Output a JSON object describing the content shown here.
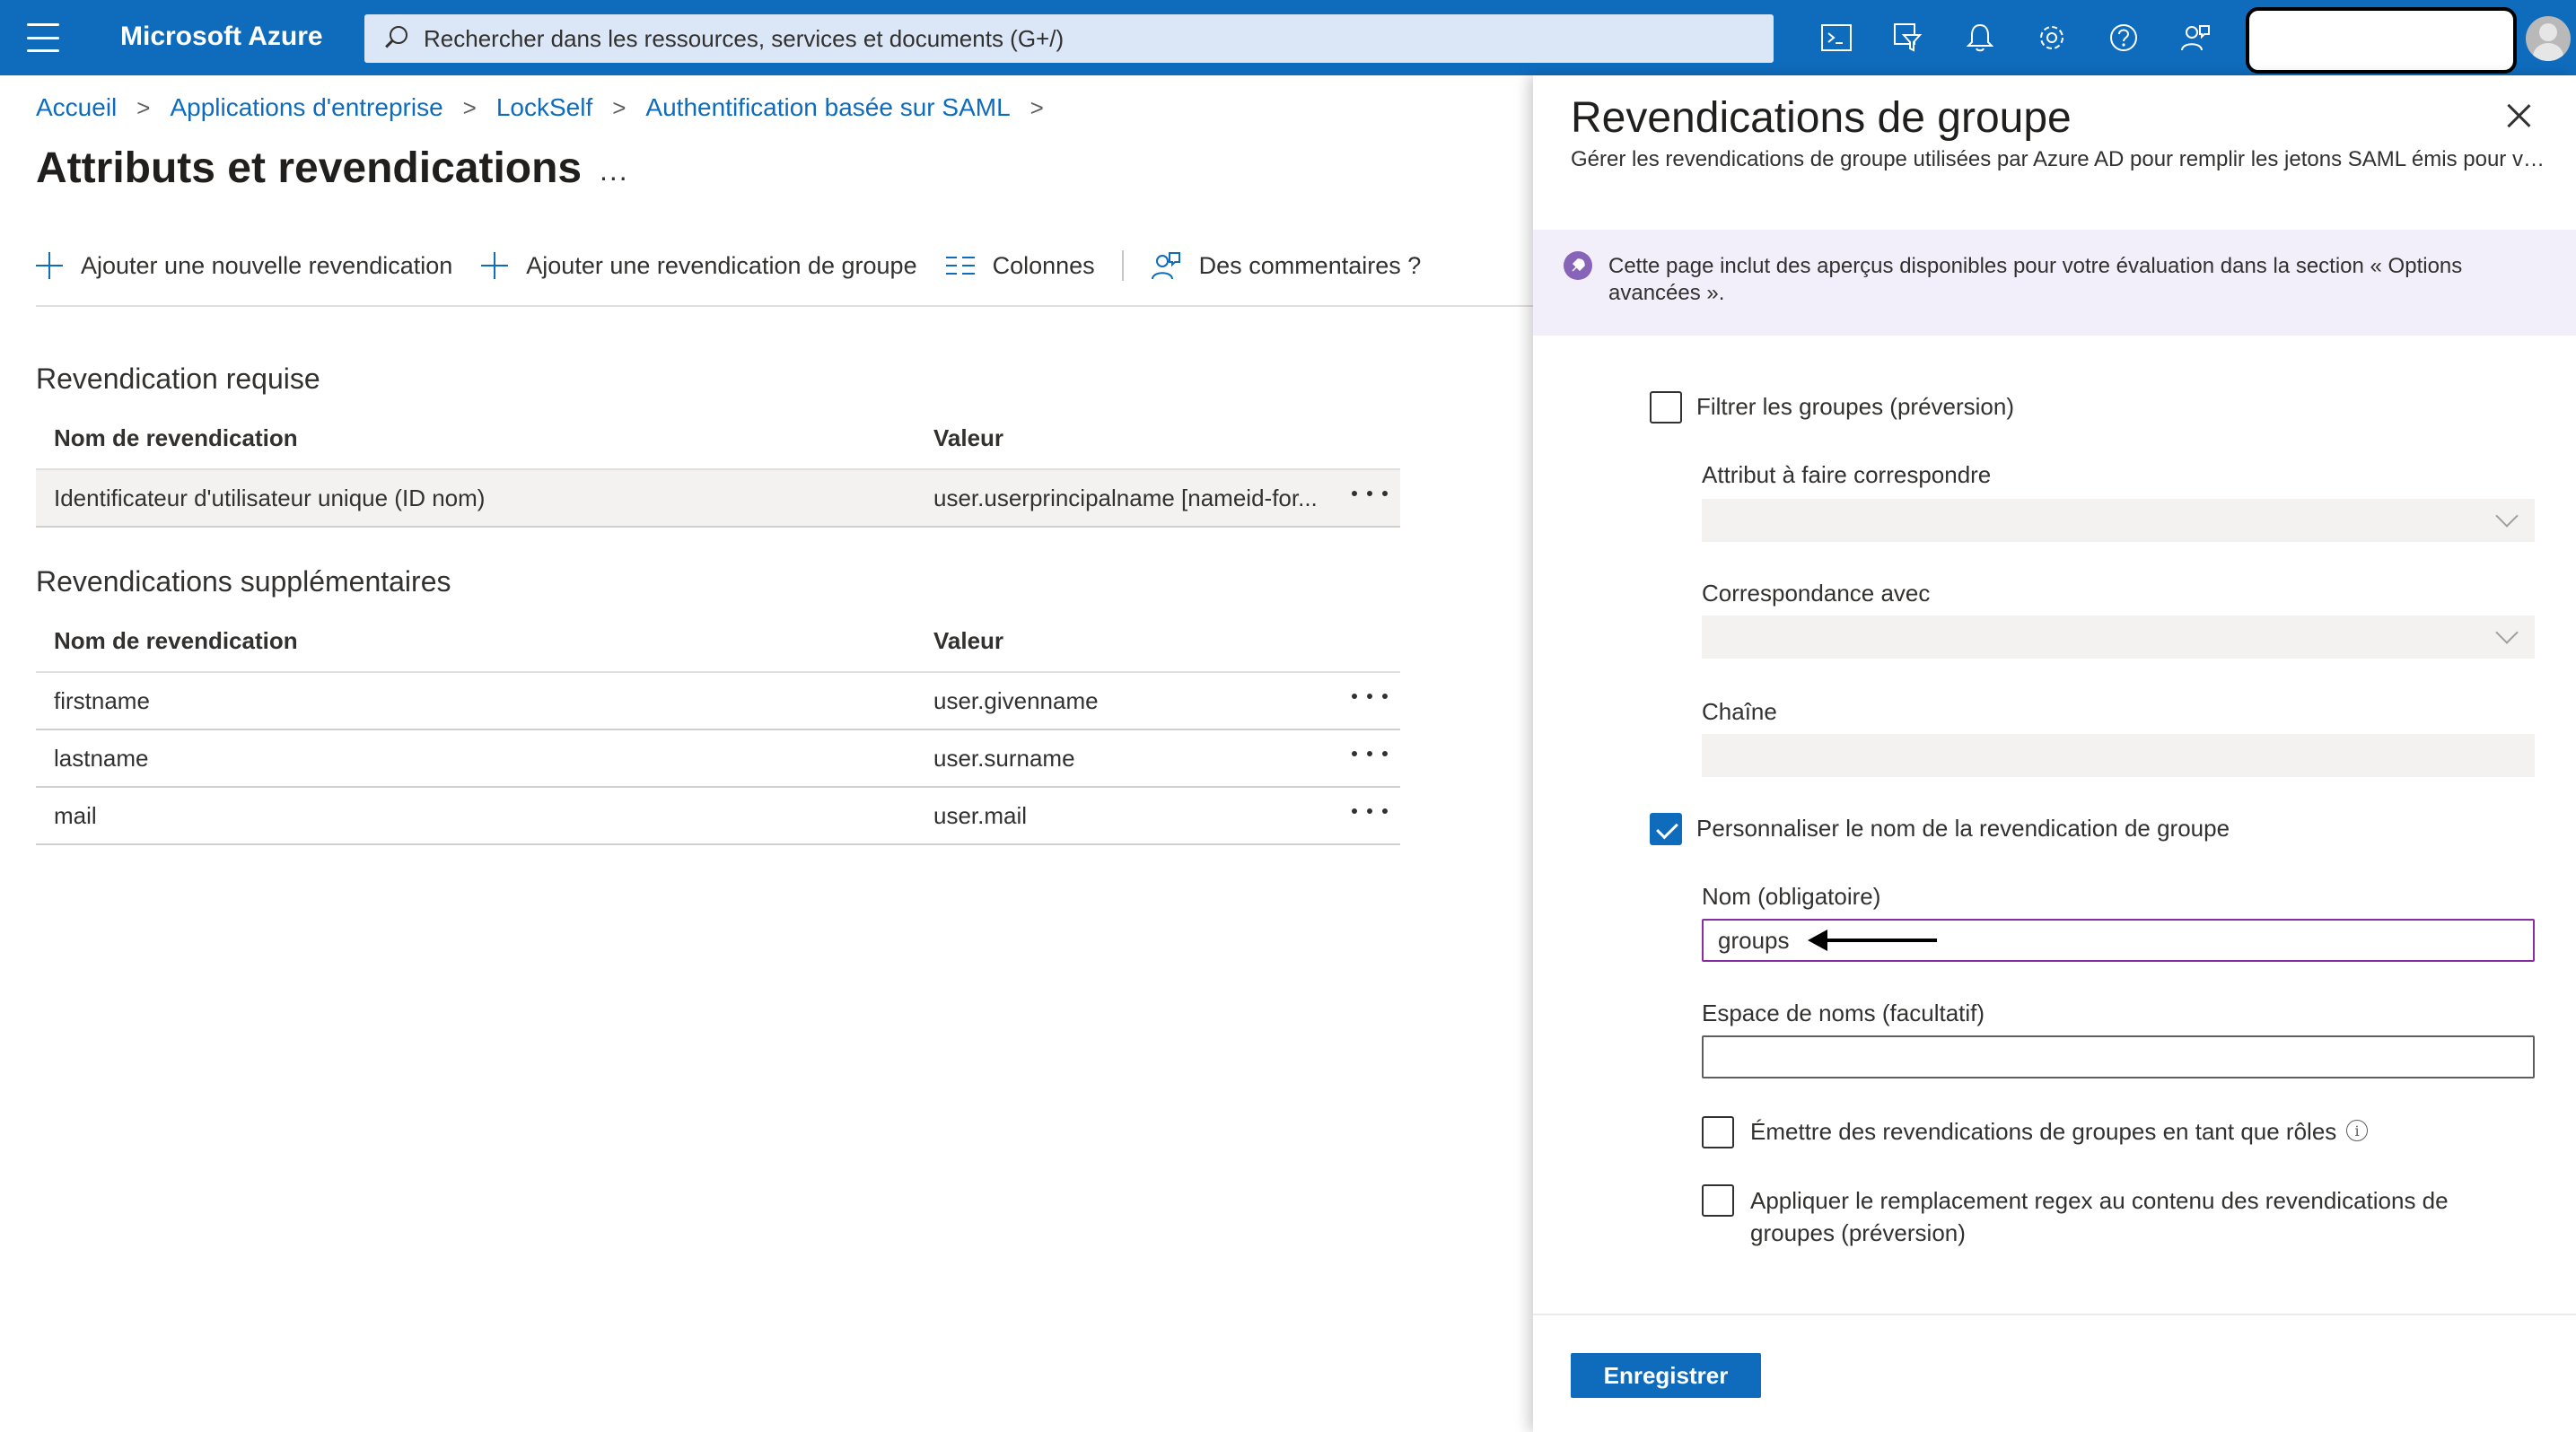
{
  "topbar": {
    "brand": "Microsoft Azure",
    "search_placeholder": "Rechercher dans les ressources, services et documents (G+/)",
    "icons": [
      "menu-icon",
      "cloud-shell-icon",
      "directory-filter-icon",
      "notifications-icon",
      "settings-icon",
      "help-icon",
      "feedback-icon"
    ]
  },
  "breadcrumb": {
    "items": [
      "Accueil",
      "Applications d'entreprise",
      "LockSelf",
      "Authentification basée sur SAML"
    ]
  },
  "page": {
    "title": "Attributs et revendications",
    "more": "..."
  },
  "toolbar": {
    "add_claim": "Ajouter une nouvelle revendication",
    "add_group_claim": "Ajouter une revendication de groupe",
    "columns": "Colonnes",
    "feedback": "Des commentaires ?"
  },
  "required_claims": {
    "title": "Revendication requise",
    "headers": [
      "Nom de revendication",
      "Valeur"
    ],
    "rows": [
      {
        "name": "Identificateur d'utilisateur unique (ID nom)",
        "value": "user.userprincipalname [nameid-for..."
      }
    ]
  },
  "additional_claims": {
    "title": "Revendications supplémentaires",
    "headers": [
      "Nom de revendication",
      "Valeur"
    ],
    "rows": [
      {
        "name": "firstname",
        "value": "user.givenname"
      },
      {
        "name": "lastname",
        "value": "user.surname"
      },
      {
        "name": "mail",
        "value": "user.mail"
      }
    ]
  },
  "panel": {
    "title": "Revendications de groupe",
    "subtitle": "Gérer les revendications de groupe utilisées par Azure AD pour remplir les jetons SAML émis pour vo...",
    "preview_banner": "Cette page inclut des aperçus disponibles pour votre évaluation dans la section « Options avancées ».",
    "filter_groups": {
      "label": "Filtrer les groupes (préversion)",
      "checked": false
    },
    "attribute_to_match": {
      "label": "Attribut à faire correspondre",
      "value": ""
    },
    "match_with": {
      "label": "Correspondance avec",
      "value": ""
    },
    "string": {
      "label": "Chaîne",
      "value": ""
    },
    "customize_name": {
      "label": "Personnaliser le nom de la revendication de groupe",
      "checked": true
    },
    "name_field": {
      "label": "Nom (obligatoire)",
      "value": "groups"
    },
    "namespace_field": {
      "label": "Espace de noms (facultatif)",
      "value": ""
    },
    "emit_as_roles": {
      "label": "Émettre des revendications de groupes en tant que rôles",
      "checked": false,
      "info": "i"
    },
    "regex_replace": {
      "label": "Appliquer le remplacement regex au contenu des revendications de groupes (préversion)",
      "checked": false
    },
    "save_label": "Enregistrer"
  },
  "colors": {
    "brand_blue": "#0f6cbd",
    "focus_purple": "#8a2da5",
    "preview_bg": "#f3effa"
  }
}
